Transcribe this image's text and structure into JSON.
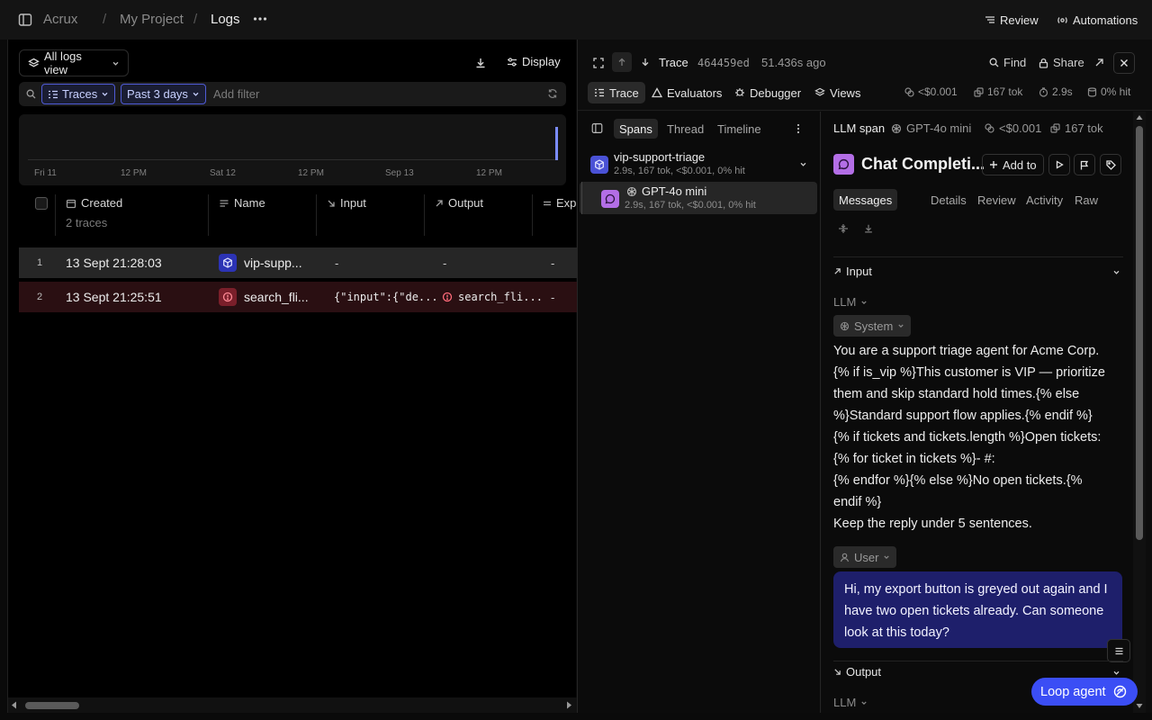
{
  "topbar": {
    "org": "Acrux",
    "separator": "/",
    "project": "My Project",
    "page": "Logs",
    "review_label": "Review",
    "automations_label": "Automations"
  },
  "logs": {
    "view_label": "All logs view",
    "display_label": "Display",
    "filter_traces": "Traces",
    "filter_range": "Past 3 days",
    "add_filter": "Add filter",
    "histogram_labels": [
      "Fri 11",
      "12 PM",
      "Sat 12",
      "12 PM",
      "Sep 13",
      "12 PM"
    ],
    "columns": {
      "created": "Created",
      "name": "Name",
      "input": "Input",
      "output": "Output",
      "exp": "Exp"
    },
    "trace_count": "2 traces",
    "rows": [
      {
        "num": "1",
        "created": "13 Sept 21:28:03",
        "name": "vip-supp...",
        "input": "-",
        "output": "-",
        "exp": "-",
        "status": "ok"
      },
      {
        "num": "2",
        "created": "13 Sept 21:25:51",
        "name": "search_fli...",
        "input": "{\"input\":{\"de...",
        "output": "search_fli...",
        "exp": "-",
        "status": "error"
      }
    ]
  },
  "trace": {
    "label": "Trace",
    "id": "464459ed",
    "age": "51.436s ago",
    "find_label": "Find",
    "share_label": "Share",
    "tabs": [
      "Trace",
      "Evaluators",
      "Debugger",
      "Views"
    ],
    "stats": {
      "cost": "<$0.001",
      "tokens": "167 tok",
      "duration": "2.9s",
      "hit": "0% hit"
    }
  },
  "spans": {
    "tabs": [
      "Spans",
      "Thread",
      "Timeline"
    ],
    "items": [
      {
        "title": "vip-support-triage",
        "meta": "2.9s, 167 tok, <$0.001, 0% hit"
      },
      {
        "title": "GPT-4o mini",
        "meta": "2.9s, 167 tok, <$0.001, 0% hit"
      }
    ]
  },
  "detail": {
    "span_type": "LLM span",
    "model": "GPT-4o mini",
    "cost": "<$0.001",
    "tokens": "167 tok",
    "title": "Chat Completi...",
    "add_to_label": "Add to",
    "tabs": [
      "Messages",
      "Details",
      "Review",
      "Activity",
      "Raw"
    ],
    "input_label": "Input",
    "llm_label": "LLM",
    "system_label": "System",
    "system_prompt": "You are a support triage agent for Acme Corp.\n{% if is_vip %}This customer is VIP — prioritize\nthem and skip standard hold times.{% else\n%}Standard support flow applies.{% endif %}\n{% if tickets and tickets.length %}Open tickets:\n{% for ticket in tickets %}- #:\n{% endfor %}{% else %}No open tickets.{%\nendif %}\nKeep the reply under 5 sentences.",
    "user_label": "User",
    "user_message": "Hi, my export button is greyed out again and I have two open tickets already. Can someone look at this today?",
    "output_label": "Output",
    "output_llm_label": "LLM"
  },
  "loop_agent_label": "Loop agent",
  "colors": {
    "accent": "#3b4ef5",
    "error_row": "#2a0f12",
    "user_bubble": "#1e1f6b"
  }
}
